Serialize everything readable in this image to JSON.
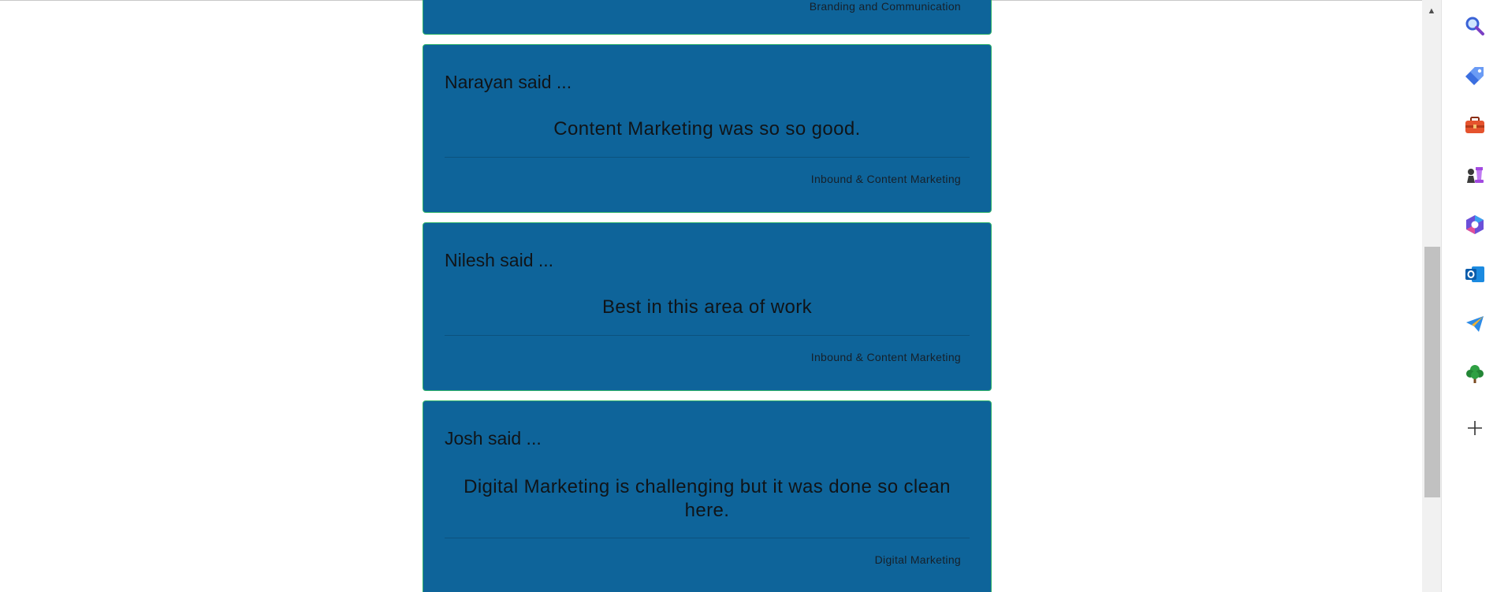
{
  "cards": [
    {
      "author": "",
      "quote": "",
      "category": "Branding and Communication"
    },
    {
      "author": "Narayan said ...",
      "quote": "Content Marketing was so so good.",
      "category": "Inbound & Content Marketing"
    },
    {
      "author": "Nilesh said ...",
      "quote": "Best in this area of work",
      "category": "Inbound & Content Marketing"
    },
    {
      "author": "Josh said ...",
      "quote": "Digital Marketing is challenging but it was done so clean here.",
      "category": "Digital Marketing"
    }
  ],
  "sidebar": {
    "items": [
      {
        "icon": "search-icon"
      },
      {
        "icon": "shopping-tag-icon"
      },
      {
        "icon": "tools-briefcase-icon"
      },
      {
        "icon": "games-chess-icon"
      },
      {
        "icon": "microsoft-365-icon"
      },
      {
        "icon": "outlook-icon"
      },
      {
        "icon": "telegram-send-icon"
      },
      {
        "icon": "tree-icon"
      },
      {
        "icon": "add-icon"
      }
    ]
  },
  "colors": {
    "card_background": "#0e649a",
    "card_border": "#2fb36a",
    "text": "#101418"
  }
}
